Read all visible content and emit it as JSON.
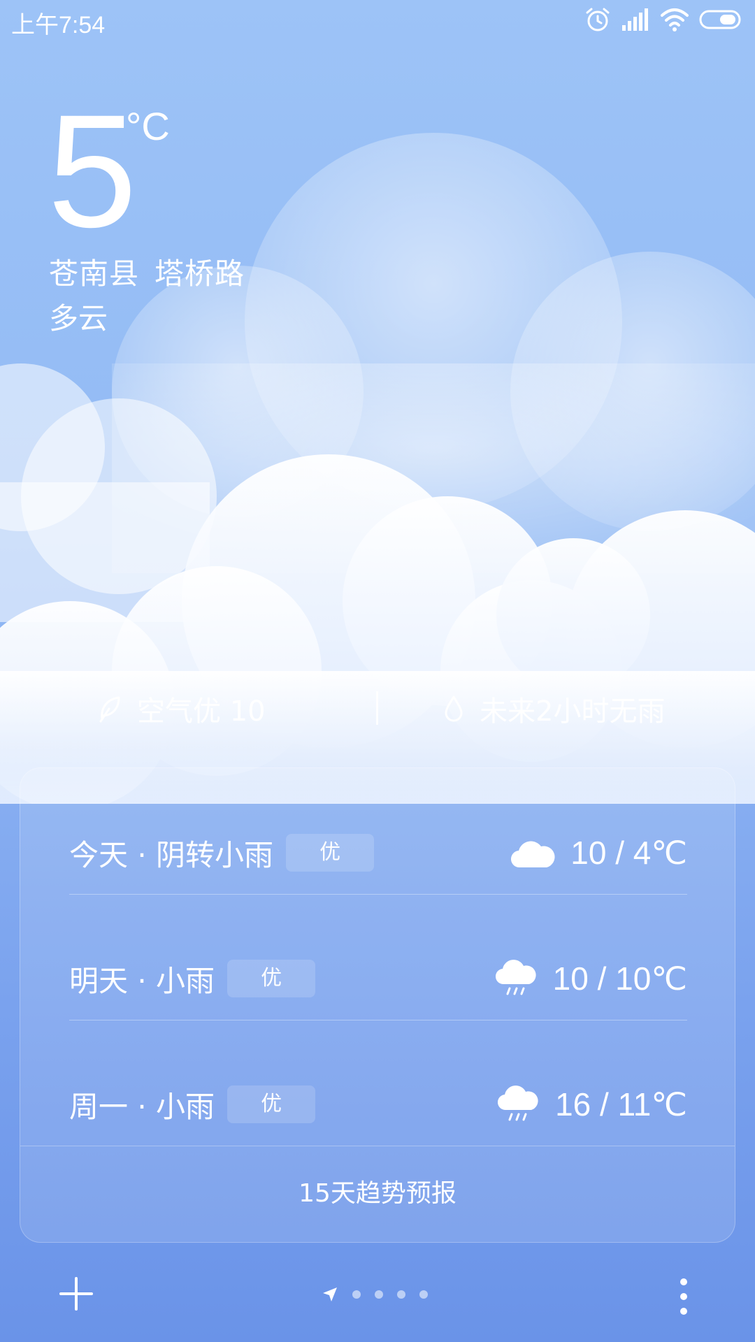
{
  "status_bar": {
    "time": "上午7:54",
    "icons": [
      "alarm-icon",
      "signal-icon",
      "wifi-icon",
      "battery-icon"
    ]
  },
  "current": {
    "temperature": "5",
    "unit": "°C",
    "district": "苍南县",
    "street": "塔桥路",
    "condition": "多云"
  },
  "info": {
    "air_quality": "空气优 10",
    "rain_forecast": "未来2小时无雨"
  },
  "forecast": [
    {
      "day": "今天 · 阴转小雨",
      "aqi": "优",
      "icon": "cloud-icon",
      "range": "10 / 4℃"
    },
    {
      "day": "明天 · 小雨",
      "aqi": "优",
      "icon": "light-rain-icon",
      "range": "10 / 10℃"
    },
    {
      "day": "周一 · 小雨",
      "aqi": "优",
      "icon": "light-rain-icon",
      "range": "16 / 11℃"
    }
  ],
  "forecast_link": "15天趋势预报",
  "pager": {
    "pages": 5,
    "current": 1
  },
  "colors": {
    "sky_top": "#9dc3f7",
    "sky_bottom": "#6a93e8",
    "text": "#ffffff"
  }
}
